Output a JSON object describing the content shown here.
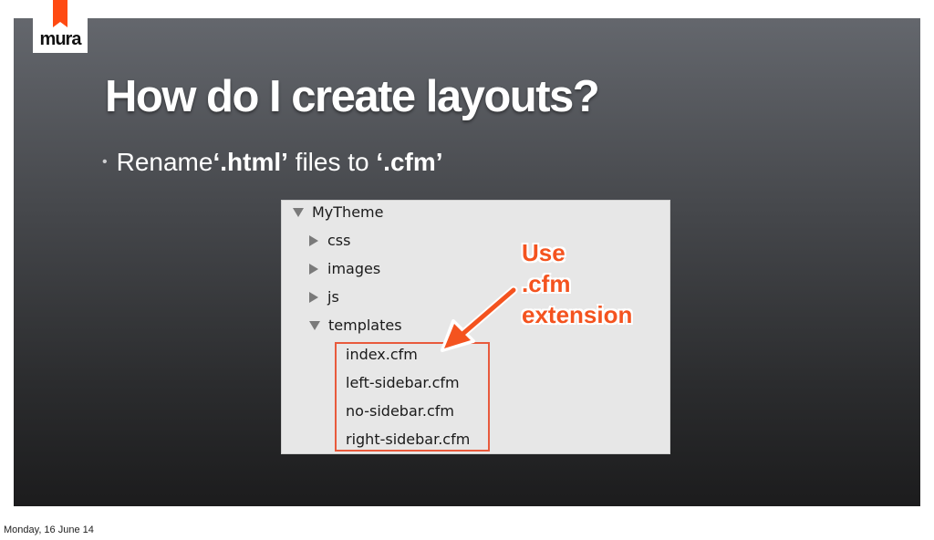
{
  "logo": {
    "text": "mura",
    "color": "#ff4a12"
  },
  "slide": {
    "title": "How do I create layouts?",
    "bullet": {
      "prefix": "Rename ",
      "from": "‘.html’",
      "middle": " files to ",
      "to": "‘.cfm’"
    }
  },
  "screenshot": {
    "tree": [
      {
        "label": "MyTheme",
        "state": "expanded"
      },
      {
        "label": "css",
        "state": "collapsed"
      },
      {
        "label": "images",
        "state": "collapsed"
      },
      {
        "label": "js",
        "state": "collapsed"
      },
      {
        "label": "templates",
        "state": "expanded"
      }
    ],
    "files": [
      "index.cfm",
      "left-sidebar.cfm",
      "no-sidebar.cfm",
      "right-sidebar.cfm"
    ],
    "callout": [
      "Use",
      ".cfm",
      "extension"
    ],
    "accent": "#f4531f"
  },
  "footer": {
    "date": "Monday, 16 June 14"
  }
}
